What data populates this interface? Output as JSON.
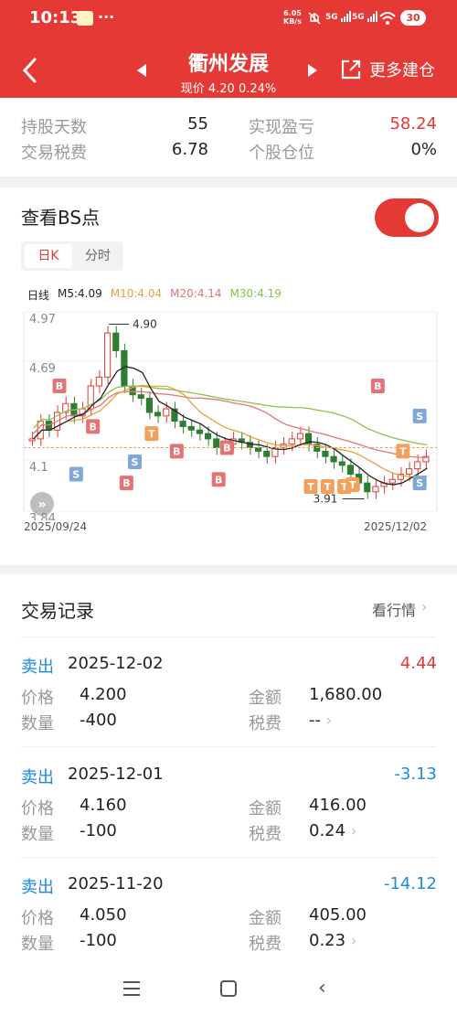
{
  "status": {
    "time": "10:13",
    "dots": "···",
    "speed_top": "6.05",
    "speed_bottom": "KB/s",
    "net1": "5G",
    "net2": "5G",
    "battery": "30"
  },
  "header": {
    "title": "衢州发展",
    "subtitle": "现价 4.20 0.24%",
    "more": "更多建仓"
  },
  "stats": {
    "hold_days_label": "持股天数",
    "hold_days": "55",
    "realized_label": "实现盈亏",
    "realized": "58.24",
    "tax_label": "交易税费",
    "tax": "6.78",
    "position_label": "个股仓位",
    "position": "0%"
  },
  "bs": {
    "title": "查看BS点",
    "toggle_on": true,
    "tab_day": "日K",
    "tab_min": "分时",
    "legend": {
      "line": "日线",
      "m5": "M5:4.09",
      "m10": "M10:4.04",
      "m20": "M20:4.14",
      "m30": "M30:4.19"
    },
    "colors": {
      "m5": "#222222",
      "m10": "#e6a23c",
      "m20": "#e57373",
      "m30": "#8bc34a",
      "up": "#e53935",
      "down": "#2e7d32",
      "marker_b": "#e57373",
      "marker_t": "#f5a05a",
      "marker_s": "#7fa7d8"
    },
    "date_start": "2025/09/24",
    "date_end": "2025/12/02"
  },
  "chart_data": {
    "type": "candlestick",
    "y_ticks": [
      "4.97",
      "4.69",
      "4.1",
      "3.84"
    ],
    "high_label": "4.90",
    "low_label": "3.91",
    "ylim": [
      3.84,
      4.97
    ],
    "marker_labels": {
      "buy": "B",
      "t": "T",
      "sell": "S"
    }
  },
  "trades": {
    "title": "交易记录",
    "link": "看行情",
    "rows": [
      {
        "type": "卖出",
        "date": "2025-12-02",
        "pnl": "4.44",
        "sign": "pos",
        "price_label": "价格",
        "price": "4.200",
        "amount_label": "金额",
        "amount": "1,680.00",
        "qty_label": "数量",
        "qty": "-400",
        "fee_label": "税费",
        "fee": "--"
      },
      {
        "type": "卖出",
        "date": "2025-12-01",
        "pnl": "-3.13",
        "sign": "neg",
        "price_label": "价格",
        "price": "4.160",
        "amount_label": "金额",
        "amount": "416.00",
        "qty_label": "数量",
        "qty": "-100",
        "fee_label": "税费",
        "fee": "0.24"
      },
      {
        "type": "卖出",
        "date": "2025-11-20",
        "pnl": "-14.12",
        "sign": "neg",
        "price_label": "价格",
        "price": "4.050",
        "amount_label": "金额",
        "amount": "405.00",
        "qty_label": "数量",
        "qty": "-100",
        "fee_label": "税费",
        "fee": "0.23"
      }
    ]
  }
}
